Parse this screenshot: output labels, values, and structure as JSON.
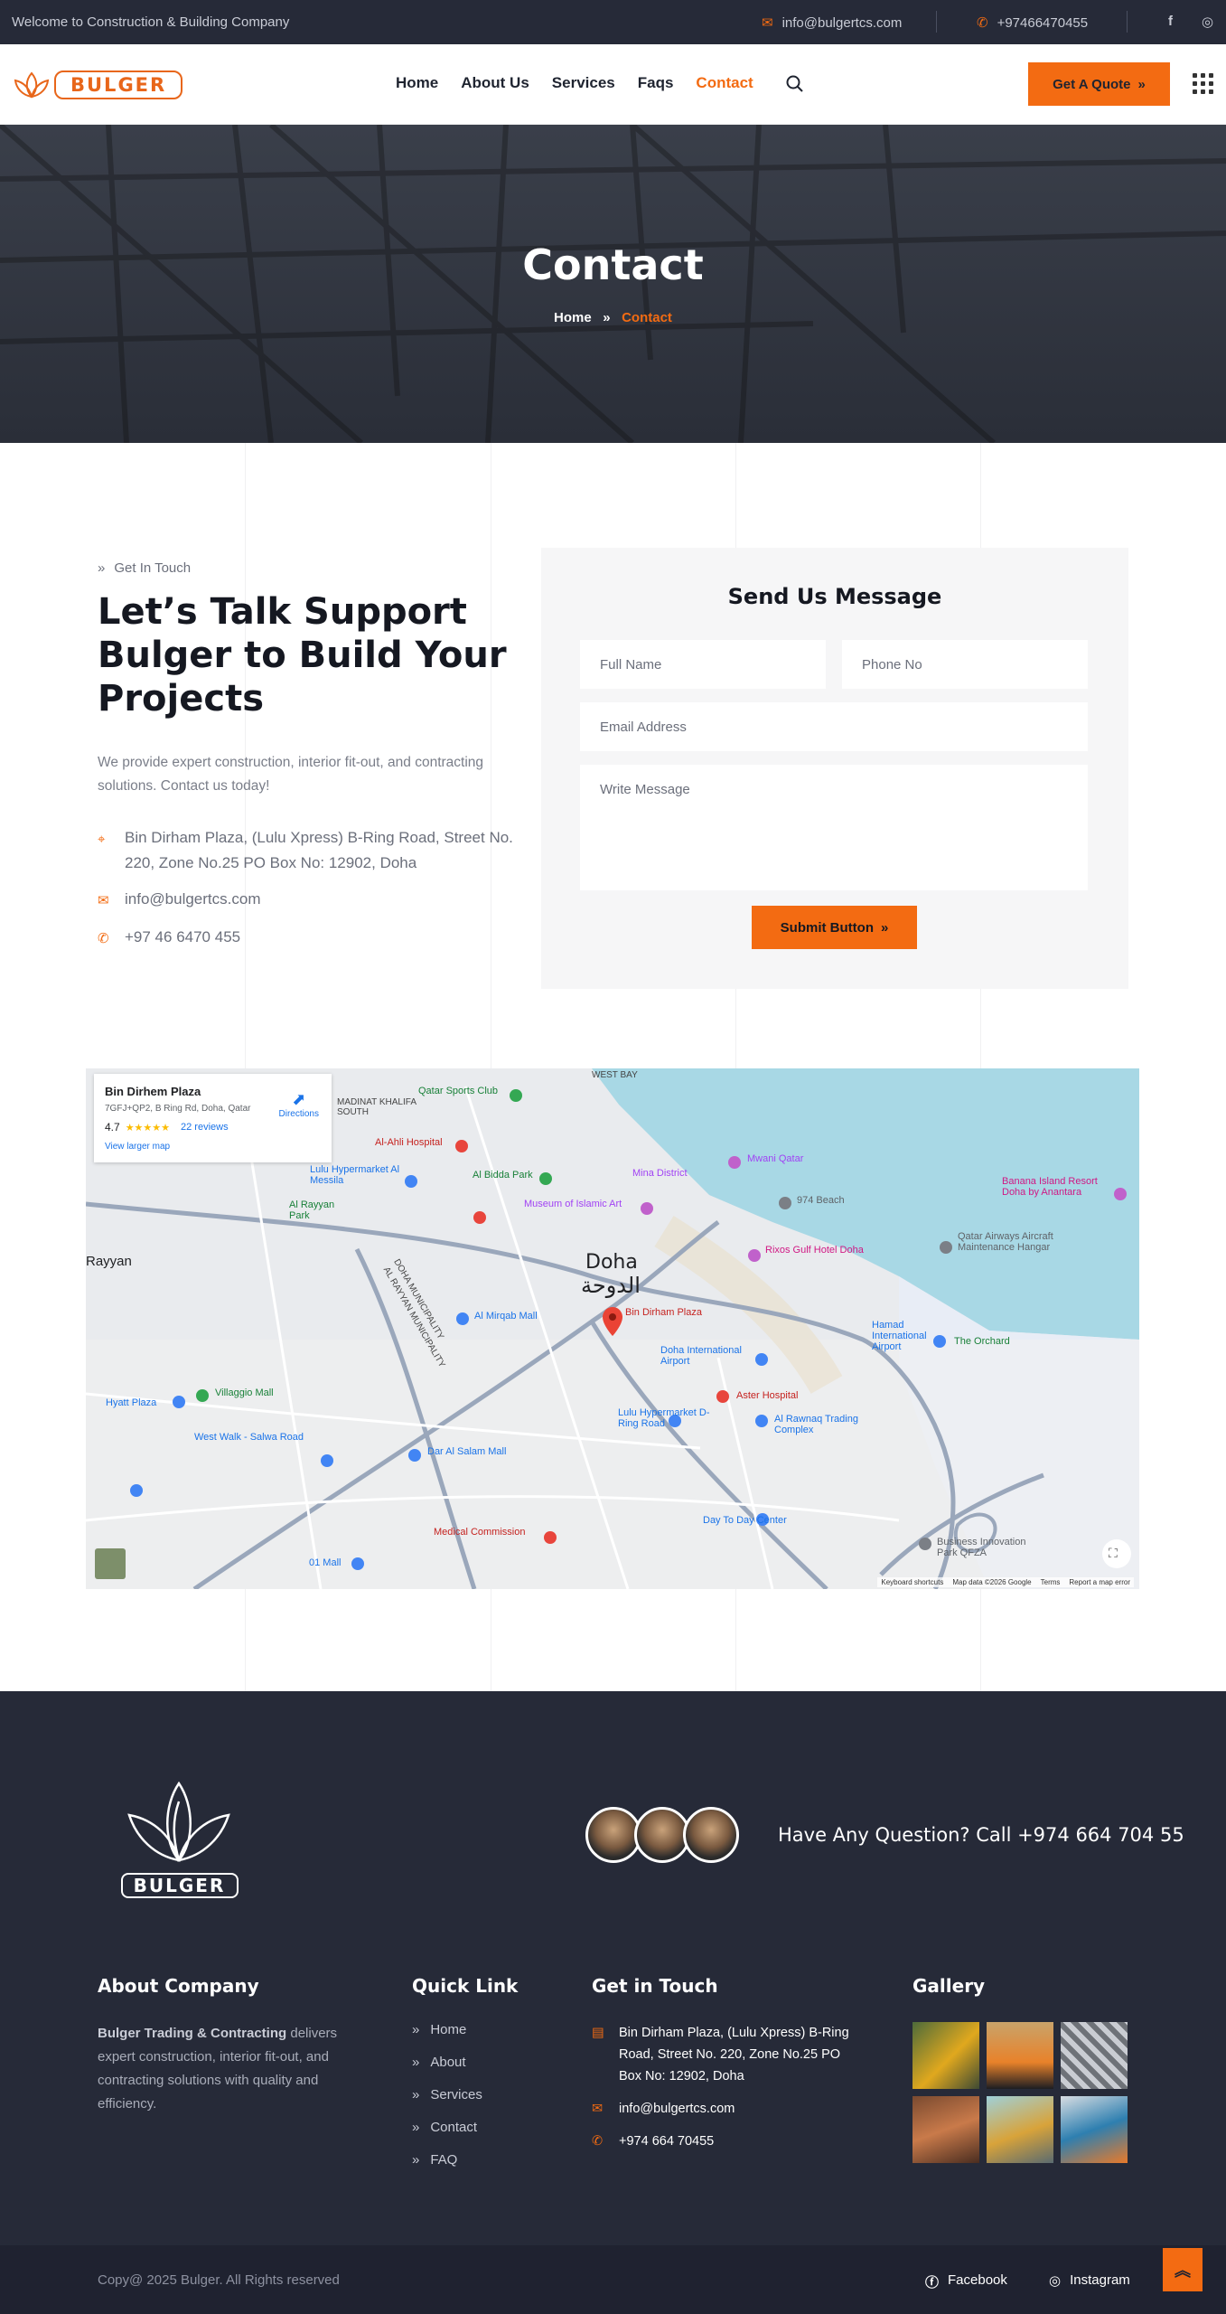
{
  "topbar": {
    "welcome": "Welcome to Construction & Building Company",
    "email": "info@bulgertcs.com",
    "phone": "+97466470455",
    "social": [
      "facebook-icon",
      "instagram-icon"
    ]
  },
  "nav": {
    "logo_text": "BULGER",
    "menu": [
      "Home",
      "About Us",
      "Services",
      "Faqs",
      "Contact"
    ],
    "active": "Contact",
    "quote_button": "Get A Quote"
  },
  "hero": {
    "title": "Contact",
    "crumb_home": "Home",
    "crumb_current": "Contact"
  },
  "contact": {
    "tag": "Get In Touch",
    "heading": "Let’s Talk Support Bulger to Build Your Projects",
    "lead": "We provide expert construction, interior fit-out, and contracting solutions. Contact us today!",
    "address": "Bin Dirham Plaza, (Lulu Xpress) B-Ring Road, Street No. 220, Zone No.25 PO Box No: 12902, Doha",
    "email": "info@bulgertcs.com",
    "phone": "+97 46 6470 455"
  },
  "form": {
    "title": "Send Us Message",
    "full_name": "Full Name",
    "phone": "Phone No",
    "email": "Email Address",
    "message": "Write Message",
    "submit": "Submit Button"
  },
  "map": {
    "place": "Bin Dirhem Plaza",
    "plus_code": "7GFJ+QP2, B Ring Rd, Doha, Qatar",
    "rating": "4.7",
    "stars": "★★★★★",
    "reviews": "22 reviews",
    "larger": "View larger map",
    "directions": "Directions",
    "city": "Doha",
    "city_ar": "الدوحة",
    "pin_label": "Bin Dirham Plaza",
    "footer_links": [
      "Keyboard shortcuts",
      "Map data ©2026 Google",
      "Terms",
      "Report a map error"
    ],
    "pois": [
      "Qatar Sports Club",
      "Al-Ahli Hospital",
      "Al Bidda Park",
      "Museum of Islamic Art",
      "Mina District",
      "Mwani Qatar",
      "974 Beach",
      "Rixos Gulf Hotel Doha",
      "Banana Island Resort Doha by Anantara",
      "Qatar Airways Aircraft Maintenance Hangar",
      "Hamad International Airport",
      "The Orchard",
      "Lulu Hypermarket Al Messila",
      "Al Rayyan Park",
      "Al Mirqab Mall",
      "Doha International Airport",
      "Aster Hospital",
      "Lulu Hypermarket D-Ring Road",
      "Al Rawnaq Trading Complex",
      "Villaggio Mall",
      "Hyatt Plaza",
      "West Walk - Salwa Road",
      "Dar Al Salam Mall",
      "Day To Day Center",
      "Medical Commission",
      "Business Innovation Park QFZA",
      "01 Mall",
      "Rayyan",
      "MADINAT KHALIFA SOUTH",
      "WEST BAY",
      "DOHA MUNICIPALITY",
      "AL RAYYAN MUNICIPALITY"
    ]
  },
  "footer": {
    "question": "Have Any Question? Call +974 664 704 55",
    "logo_text": "BULGER",
    "about_title": "About Company",
    "about_bold": "Bulger Trading & Contracting",
    "about_text": " delivers expert construction, interior fit-out, and contracting solutions with quality and efficiency.",
    "quick_title": "Quick Link",
    "quick": [
      "Home",
      "About",
      "Services",
      "Contact",
      "FAQ"
    ],
    "touch_title": "Get in Touch",
    "address": "Bin Dirham Plaza, (Lulu Xpress) B-Ring Road, Street No. 220, Zone No.25 PO Box No: 12902, Doha",
    "email": "info@bulgertcs.com",
    "phone": "+974 664 70455",
    "gallery_title": "Gallery",
    "copyright": "Copy@ 2025 Bulger. All Rights reserved",
    "facebook": "Facebook",
    "instagram": "Instagram"
  },
  "colors": {
    "accent": "#f36b12",
    "dark": "#262a38"
  }
}
